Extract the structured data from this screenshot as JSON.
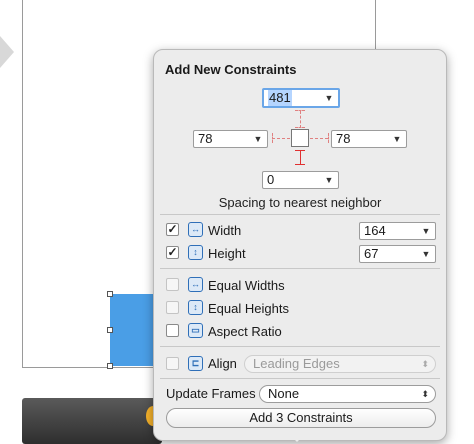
{
  "popover": {
    "title": "Add New Constraints",
    "spacing": {
      "top": "481",
      "left": "78",
      "right": "78",
      "bottom": "0",
      "label": "Spacing to nearest neighbor"
    },
    "width": {
      "label": "Width",
      "value": "164",
      "checked": true
    },
    "height": {
      "label": "Height",
      "value": "67",
      "checked": true
    },
    "equal_widths": "Equal Widths",
    "equal_heights": "Equal Heights",
    "aspect_ratio": "Aspect Ratio",
    "align": {
      "label": "Align",
      "value": "Leading Edges"
    },
    "update_frames": {
      "label": "Update Frames",
      "value": "None"
    },
    "add_button": "Add 3 Constraints"
  },
  "icons": {
    "dropdown": "▼",
    "popup": "⬍",
    "check": "✓"
  },
  "colors": {
    "accent": "#4a9ee6",
    "constraint_red": "#e03030",
    "popover_bg": "#ececec"
  }
}
